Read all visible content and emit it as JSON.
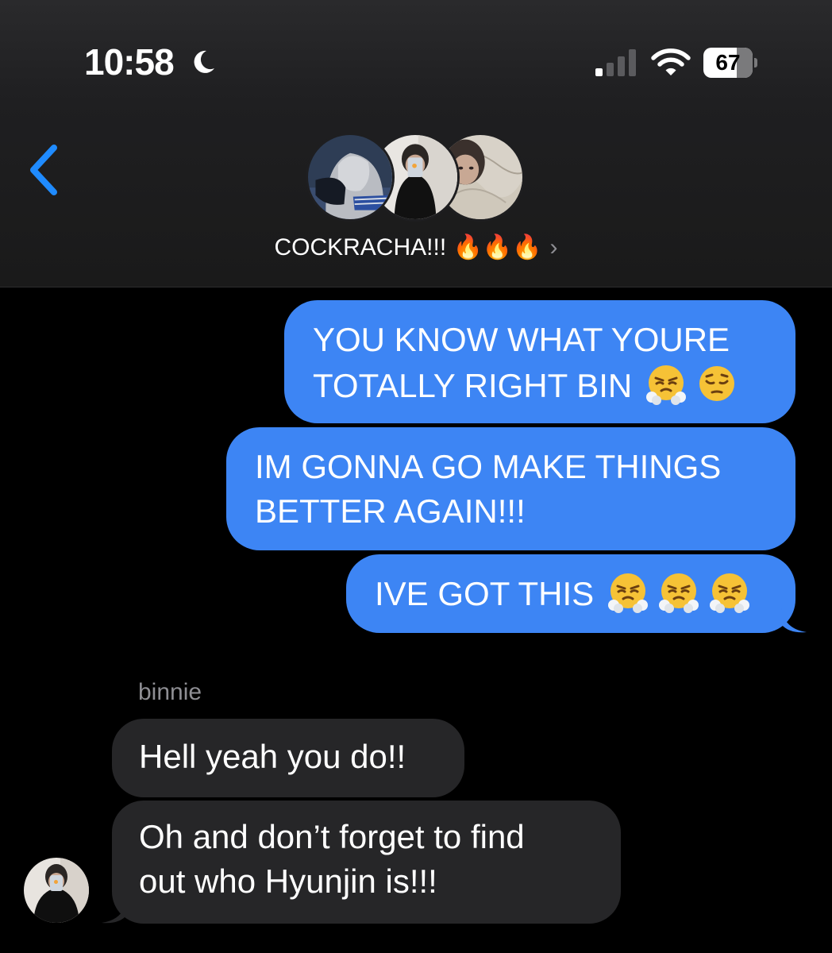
{
  "status_bar": {
    "time": "10:58",
    "battery": "67"
  },
  "conversation": {
    "name": "COCKRACHA!!! 🔥🔥🔥",
    "chevron": "›"
  },
  "messages": [
    {
      "direction": "outgoing",
      "lines": [
        "YOU KNOW WHAT YOURE",
        "TOTALLY RIGHT BIN"
      ],
      "emojis": [
        "😤",
        "😔"
      ]
    },
    {
      "direction": "outgoing",
      "lines": [
        "IM GONNA GO MAKE THINGS",
        "BETTER AGAIN!!!"
      ]
    },
    {
      "direction": "outgoing",
      "lines": [
        "IVE GOT THIS"
      ],
      "emojis": [
        "😤",
        "😤",
        "😤"
      ]
    },
    {
      "direction": "incoming",
      "sender": "binnie",
      "lines": [
        "Hell yeah you do!!"
      ]
    },
    {
      "direction": "incoming",
      "lines": [
        "Oh and don’t forget to find",
        "out who Hyunjin is!!!"
      ]
    }
  ],
  "colors": {
    "outgoing_bubble": "#3d85f4",
    "incoming_bubble": "#262628",
    "accent": "#1f8bff"
  },
  "icons": {
    "moon": "moon-icon",
    "signal": "signal-icon",
    "wifi": "wifi-icon",
    "battery": "battery-icon",
    "back": "chevron-left-icon",
    "emoji_huffing": "face-with-steam-from-nose-emoji",
    "emoji_pensive": "pensive-face-emoji"
  }
}
